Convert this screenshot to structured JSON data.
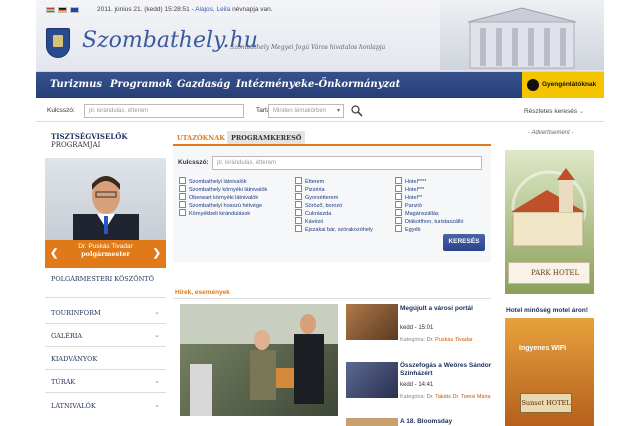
{
  "topbar": {
    "datetime": "2011. június 21. (kedd) 15:28:51 -",
    "names": "Alajos, Leila",
    "suffix": "névnapja van."
  },
  "brand": {
    "title": "Szombathely.hu",
    "subtitle": "Szombathely Megyei Jogú Város hivatalos honlapja"
  },
  "nav": {
    "items": [
      "Turizmus",
      "Programok",
      "Gazdaság",
      "Intézmények",
      "e-Önkormányzat"
    ],
    "accessibility": "Gyengénlátóknak"
  },
  "search": {
    "keyword_label": "Kulcsszó:",
    "keyword_placeholder": "pl. kirándulás, étterem",
    "content_label": "Tartalom:",
    "content_value": "Minden témakörben",
    "advanced": "Részletes keresés"
  },
  "mayor": {
    "title_line1": "TISZTSÉGVISELŐK",
    "title_line2": "PROGRAMJAI",
    "name": "Dr. Puskás Tivadar",
    "role": "polgármester"
  },
  "left_menu": [
    {
      "label": "POLGÁRMESTERI KÖSZÖNTŐ",
      "chevron": false
    },
    {
      "label": "TOURINFORM",
      "chevron": true
    },
    {
      "label": "GALÉRIA",
      "chevron": true
    },
    {
      "label": "KIADVÁNYOK",
      "chevron": false
    },
    {
      "label": "TÚRÁK",
      "chevron": true
    },
    {
      "label": "LÁTNIVALÓK",
      "chevron": true
    }
  ],
  "tabs": [
    "UTAZÓKNAK",
    "PROGRAMKERESŐ"
  ],
  "panel": {
    "keyword_label": "Kulcsszó:",
    "keyword_placeholder": "pl. kirándulás, étterem",
    "col1": [
      "Szombathelyi látnivalók",
      "Szombathely környéki látnivalók",
      "Oberwart környéki látnivalók",
      "Szombathelyi hosszú hétvége",
      "Környékbeli kirándulások"
    ],
    "col2": [
      "Étterem",
      "Pizzéria",
      "Gyorsétterem",
      "Söröző, borozó",
      "Cukrászda",
      "Kávézó",
      "Éjszakai bár, szórakozóhely"
    ],
    "col3": [
      "Hotel****",
      "Hotel***",
      "Hotel**",
      "Panzió",
      "Magánszállás",
      "Diákotthon, turistaszálló",
      "Egyéb"
    ],
    "button": "KERESÉS"
  },
  "news": {
    "heading": "Hírek, események",
    "items": [
      {
        "title": "Megújult a városi portál",
        "time": "kedd - 15:01",
        "category_label": "Kategória:",
        "category": "Dr. Puskás Tivadar"
      },
      {
        "title": "Összefogás a Weöres Sándor Színházért",
        "time": "kedd - 14:41",
        "category_label": "Kategória:",
        "category": "Dr. Takáts Dr. Tamsi Mária"
      },
      {
        "title": "A 18. Bloomsday",
        "time": "",
        "category_label": "",
        "category": ""
      }
    ]
  },
  "ads": {
    "label": "- Advertisement -",
    "ad1_brand": "PARK HOTEL",
    "ad2_title": "Hotel minőség motel áron!",
    "ad2_wifi": "Ingyenes WIFI",
    "ad2_brand": "Sunset HOTEL"
  }
}
